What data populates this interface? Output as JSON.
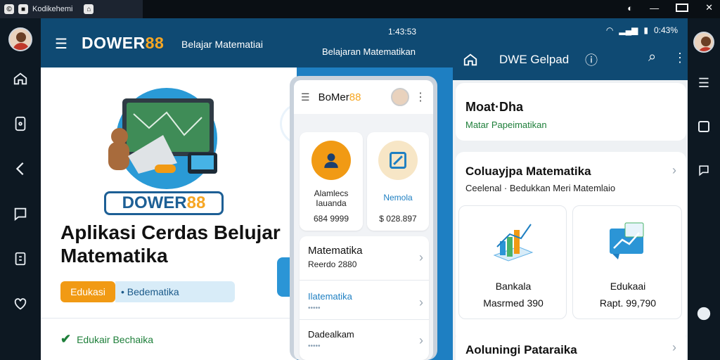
{
  "os_bar": {
    "tab_label": "Kodikehemi",
    "controls": [
      "minimize-icon",
      "maximize-icon",
      "close-icon"
    ]
  },
  "left_rail": {
    "icons": [
      "home-icon",
      "tablet-icon",
      "back-icon",
      "chat-icon",
      "doc-icon",
      "heart-icon"
    ]
  },
  "left_app": {
    "brand_primary": "DOWER",
    "brand_accent": "88",
    "header_subtitle": "Belajar Matematiai",
    "header_subtitle2": "Belajaran Matematikan",
    "status_time": "1:43:53",
    "hero_logo_primary": "DOWER",
    "hero_logo_accent": "88",
    "hero_title_line1": "Aplikasi Cerdas Belujar",
    "hero_title_line2": "Matematika",
    "pill_orange": "Edukasi",
    "pill_light": "• Bedematika",
    "footer_item": "Edukair Bechaika"
  },
  "phone": {
    "brand_primary": "BoMer",
    "brand_accent": "88",
    "card1": {
      "label1": "Alamlecs",
      "label2": "Iauanda",
      "value": "684 9999"
    },
    "card2": {
      "label1": "Nemola",
      "value": "$ 028.897"
    },
    "list": [
      {
        "title": "Matematika",
        "sub": "Reerdo 2880"
      },
      {
        "title": "Ilatematika",
        "sub": "•••••"
      },
      {
        "title": "Dadealkam",
        "sub": "•••••"
      }
    ]
  },
  "right_app": {
    "status_text": "0:43%",
    "header_title": "DWE Gelpad",
    "section1_title": "Moat·Dha",
    "section1_sub": "Matar Papeimatikan",
    "section2_title": "Coluayjpa Matematika",
    "section2_sub": "Ceelenal · Bedukkan Meri Matemlaio",
    "tile1": {
      "title": "Bankala",
      "value": "Masrmed 390"
    },
    "tile2": {
      "title": "Edukaai",
      "value": "Rapt. 99,790"
    },
    "section3_title": "Aoluningi Pataraika"
  },
  "right_rail": {
    "icons": [
      "menu-lines-icon",
      "square-icon",
      "chat-bubble-icon",
      "shield-icon"
    ]
  },
  "colors": {
    "header_blue": "#0f4a73",
    "accent_orange": "#f19a14",
    "brand_yellow": "#f6a623",
    "panel_blue": "#1e7fc2"
  }
}
